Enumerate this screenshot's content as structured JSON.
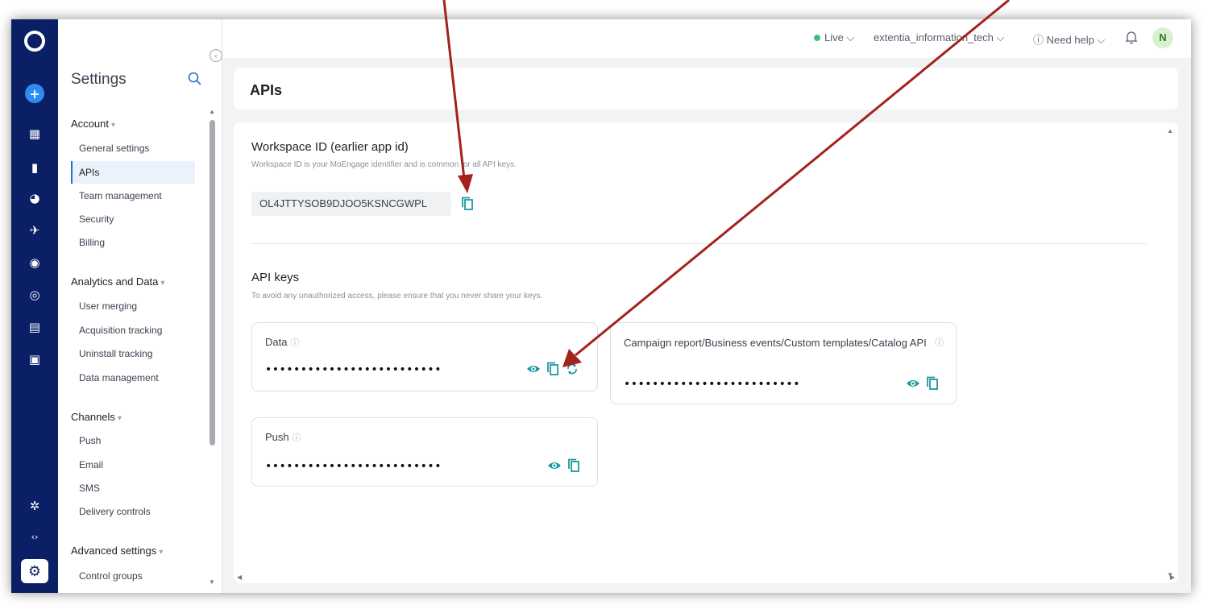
{
  "topbar": {
    "env_label": "Live",
    "workspace": "extentia_information_tech",
    "help_label": "Need help",
    "avatar_initial": "N"
  },
  "settings_nav": {
    "title": "Settings",
    "sections": [
      {
        "label": "Account",
        "items": [
          "General settings",
          "APIs",
          "Team management",
          "Security",
          "Billing"
        ]
      },
      {
        "label": "Analytics and Data",
        "items": [
          "User merging",
          "Acquisition tracking",
          "Uninstall tracking",
          "Data management"
        ]
      },
      {
        "label": "Channels",
        "items": [
          "Push",
          "Email",
          "SMS",
          "Delivery controls"
        ]
      },
      {
        "label": "Advanced settings",
        "items": [
          "Control groups"
        ]
      }
    ],
    "active_item": "APIs"
  },
  "page": {
    "title": "APIs",
    "workspace": {
      "title": "Workspace ID (earlier app id)",
      "description": "Workspace ID is your MoEngage identifier and is common for all API keys.",
      "id_value": "OL4JTTYSOB9DJOO5KSNCGWPL"
    },
    "api_keys": {
      "title": "API keys",
      "description": "To avoid any unauthorized access, please ensure that you never share your keys.",
      "keys": [
        {
          "label": "Data",
          "masked_value": "•••••••••••••••••••••••••"
        },
        {
          "label": "Campaign report/Business events/Custom templates/Catalog API",
          "masked_value": "•••••••••••••••••••••••••"
        },
        {
          "label": "Push",
          "masked_value": "•••••••••••••••••••••••••"
        }
      ]
    }
  },
  "colors": {
    "rail": "#0b1f66",
    "accent_teal": "#1a9aa0",
    "annotation_arrow": "#a4221c",
    "live_dot": "#3fbf7f"
  }
}
